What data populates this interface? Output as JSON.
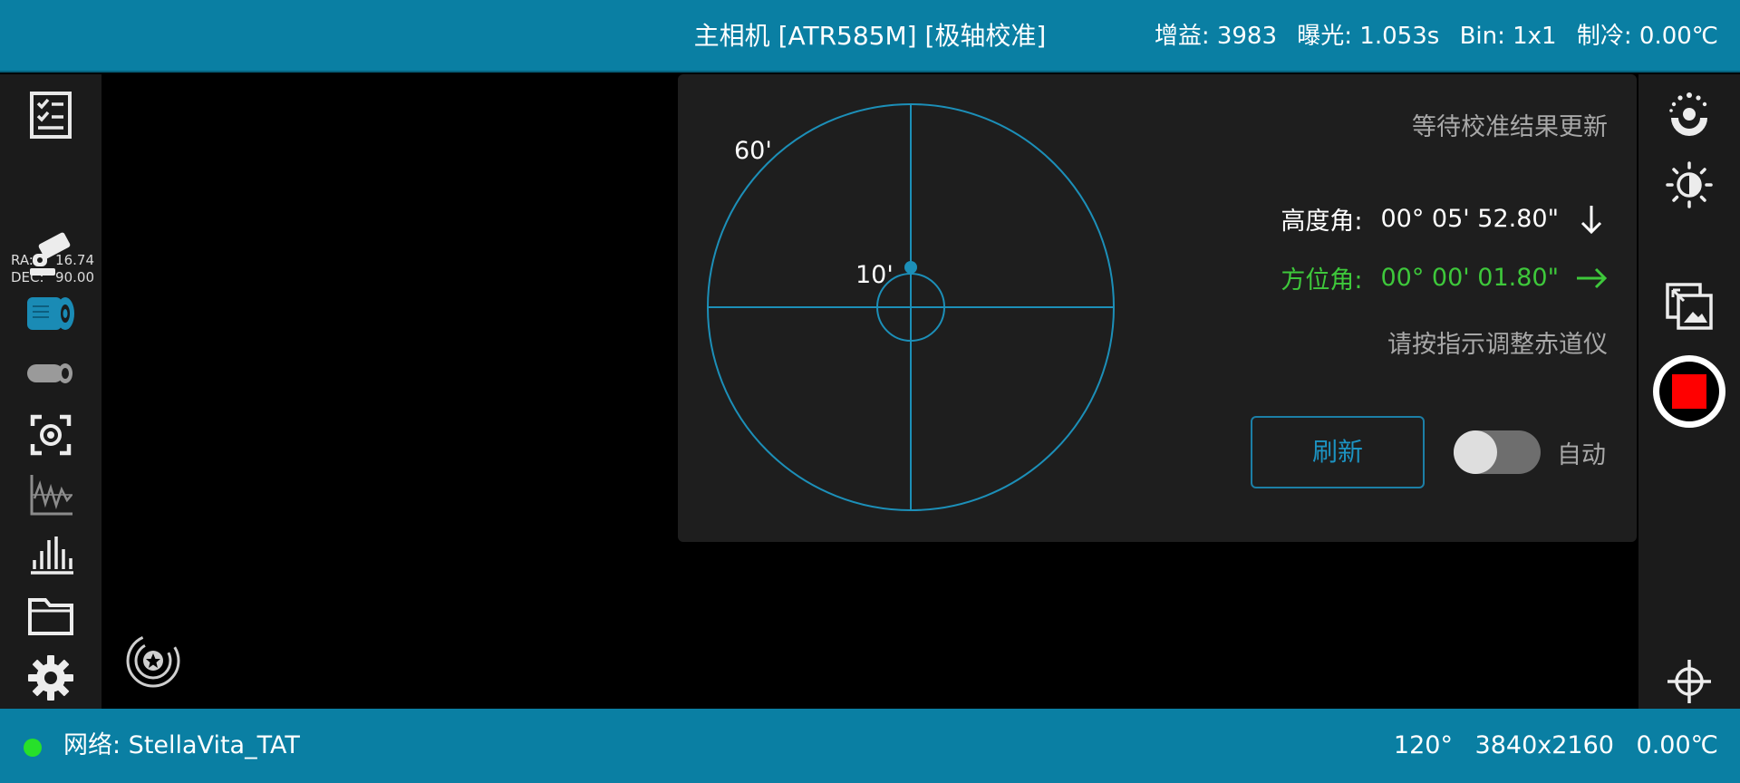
{
  "header": {
    "title": "主相机 [ATR585M] [极轴校准]",
    "gain": "增益: 3983",
    "exposure": "曝光: 1.053s",
    "bin": "Bin: 1x1",
    "cooling": "制冷: 0.00℃"
  },
  "sidebar_left": {
    "coords": {
      "ra_label": "RA:",
      "ra_value": "16.74",
      "dec_label": "DEC:",
      "dec_value": "90.00"
    },
    "items": [
      {
        "icon": "checklist-icon"
      },
      {
        "icon": "telescope-mount-icon"
      },
      {
        "icon": "main-camera-icon",
        "active": true
      },
      {
        "icon": "guide-camera-icon"
      },
      {
        "icon": "focus-target-icon"
      },
      {
        "icon": "guide-graph-icon"
      },
      {
        "icon": "histogram-icon"
      },
      {
        "icon": "folder-icon"
      },
      {
        "icon": "settings-gear-icon"
      }
    ]
  },
  "sidebar_right": {
    "items": [
      {
        "icon": "exposure-dial-icon"
      },
      {
        "icon": "brightness-icon"
      },
      {
        "icon": "image-compare-icon"
      },
      {
        "icon": "stop-capture-icon",
        "color": "#ff0000"
      },
      {
        "icon": "crosshair-icon"
      }
    ]
  },
  "polar_panel": {
    "outer_ring_label": "60'",
    "inner_ring_label": "10'",
    "status": "等待校准结果更新",
    "altitude": {
      "label": "高度角:",
      "value": "00° 05' 52.80\"",
      "arrow": "down",
      "color": "#ffffff"
    },
    "azimuth": {
      "label": "方位角:",
      "value": "00° 00' 01.80\"",
      "arrow": "right",
      "color": "#3ec83b"
    },
    "instruction": "请按指示调整赤道仪",
    "refresh_label": "刷新",
    "auto_label": "自动",
    "auto_enabled": false,
    "accent_color": "#1c8fb8"
  },
  "footer": {
    "network": "网络: StellaVita_TAT",
    "fov": "120°",
    "resolution": "3840x2160",
    "temperature": "0.00℃",
    "status_color": "#27e02a"
  }
}
